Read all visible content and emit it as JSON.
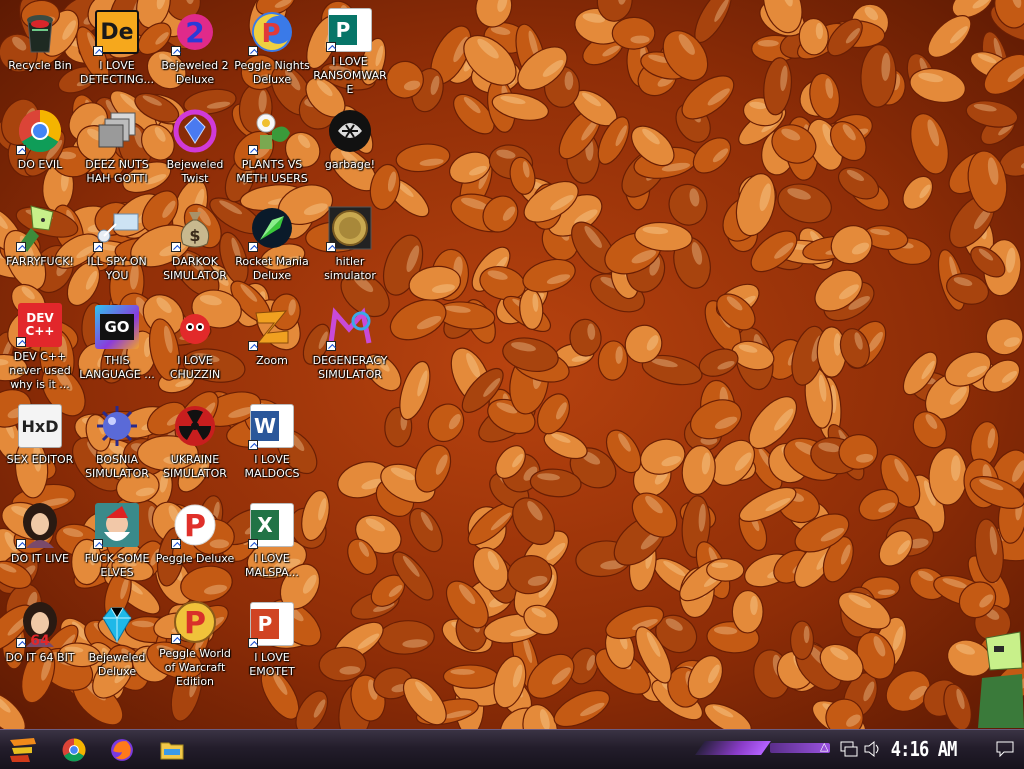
{
  "desktop": {
    "icons": [
      {
        "label": "Recycle Bin",
        "icon": "recycle-bin-icon"
      },
      {
        "label": "I LOVE DETECTING...",
        "icon": "de-icon"
      },
      {
        "label": "Bejeweled 2 Deluxe",
        "icon": "bejeweled2-icon"
      },
      {
        "label": "Peggle Nights Deluxe",
        "icon": "peggle-nights-icon"
      },
      {
        "label": "I LOVE RANSOMWARE",
        "icon": "publisher-icon"
      },
      {
        "label": "DO EVIL",
        "icon": "chrome-icon"
      },
      {
        "label": "DEEZ NUTS HAH GOTTI",
        "icon": "stacked-windows-icon"
      },
      {
        "label": "Bejeweled Twist",
        "icon": "bejeweled-twist-icon"
      },
      {
        "label": "PLANTS VS METH USERS",
        "icon": "plants-icon"
      },
      {
        "label": "garbage!",
        "icon": "garbage-icon"
      },
      {
        "label": "FARRYFUCK!",
        "icon": "peridot-icon"
      },
      {
        "label": "ILL SPY ON YOU",
        "icon": "spy-icon"
      },
      {
        "label": "DARKOK SIMULATOR",
        "icon": "money-bag-icon"
      },
      {
        "label": "Rocket Mania Deluxe",
        "icon": "rocket-icon"
      },
      {
        "label": "hitler simulator",
        "icon": "coin-icon"
      },
      {
        "label": "DEV C++ never used why is it ...",
        "icon": "devcpp-icon"
      },
      {
        "label": "THIS LANGUAGE ...",
        "icon": "go-icon"
      },
      {
        "label": "I LOVE CHUZZIN",
        "icon": "chuzzle-icon"
      },
      {
        "label": "Zoom",
        "icon": "zuma-icon"
      },
      {
        "label": "DEGENERACY SIMULATOR",
        "icon": "peggle-m-icon"
      },
      {
        "label": "SEX EDITOR",
        "icon": "hxd-icon"
      },
      {
        "label": "BOSNIA SIMULATOR",
        "icon": "mine-icon"
      },
      {
        "label": "UKRAINE SIMULATOR",
        "icon": "radiation-icon"
      },
      {
        "label": "I LOVE MALDOCS",
        "icon": "word-icon"
      },
      {
        "label": "DO IT LIVE",
        "icon": "portrait-icon"
      },
      {
        "label": "FUCK SOME ELVES",
        "icon": "santa-icon"
      },
      {
        "label": "Peggle Deluxe",
        "icon": "peggle-icon"
      },
      {
        "label": "I LOVE MALSPA...",
        "icon": "excel-icon"
      },
      {
        "label": "DO IT 64 BIT",
        "icon": "portrait64-icon"
      },
      {
        "label": "Bejeweled Deluxe",
        "icon": "diamond-icon"
      },
      {
        "label": "Peggle World of Warcraft Edition",
        "icon": "peggle-wow-icon"
      },
      {
        "label": "I LOVE EMOTET",
        "icon": "powerpoint-icon"
      }
    ],
    "devcpp_tile": "DEV C++",
    "go_tile": "GO",
    "hxd_tile": "HxD",
    "word_tile": "W",
    "excel_tile": "X",
    "ppt_tile": "P",
    "publisher_tile": "P",
    "de_tile": "De",
    "num64": "64"
  },
  "taskbar": {
    "clock": "4:16 AM",
    "pinned": [
      "chrome-icon",
      "firefox-icon",
      "file-explorer-icon"
    ],
    "tray": [
      "chevron-up-icon",
      "network-icon",
      "volume-icon",
      "action-center-icon"
    ]
  },
  "colors": {
    "bean": "#c45a14",
    "bean_light": "#e48a3a",
    "sauce": "#8e2d07",
    "taskbar": "#231d2b",
    "accent_purple": "#9a52e0"
  }
}
